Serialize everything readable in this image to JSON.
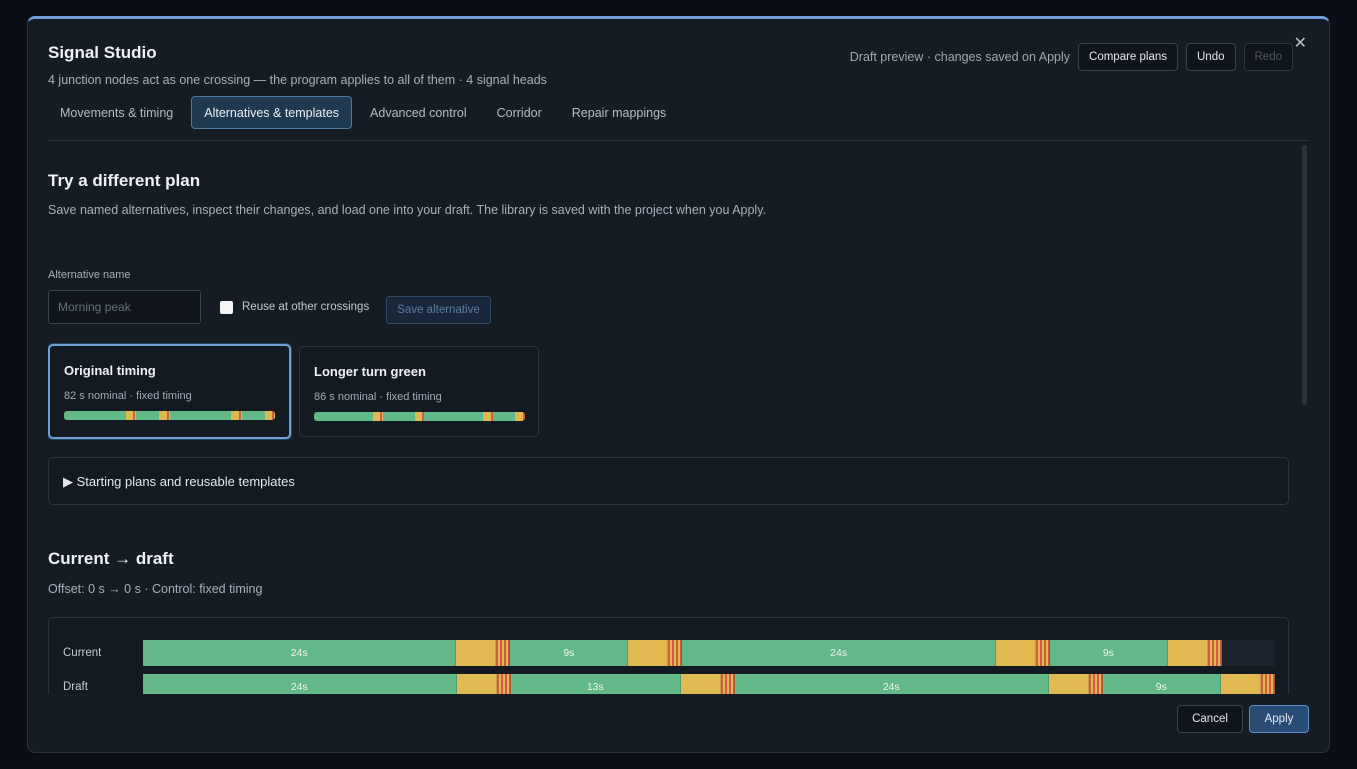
{
  "header": {
    "title": "Signal Studio",
    "subtitle": "4 junction nodes act as one crossing — the program applies to all of them · 4 signal heads",
    "draft_note": "Draft preview · changes saved on Apply",
    "compare_label": "Compare plans",
    "undo_label": "Undo",
    "redo_label": "Redo",
    "close_icon": "close-icon"
  },
  "tabs": [
    {
      "label": "Movements & timing",
      "active": false
    },
    {
      "label": "Alternatives & templates",
      "active": true
    },
    {
      "label": "Advanced control",
      "active": false
    },
    {
      "label": "Corridor",
      "active": false
    },
    {
      "label": "Repair mappings",
      "active": false
    }
  ],
  "alternatives": {
    "heading": "Try a different plan",
    "description": "Save named alternatives, inspect their changes, and load one into your draft. The library is saved with the project when you Apply.",
    "name_label": "Alternative name",
    "name_placeholder": "Morning peak",
    "name_value": "",
    "reuse_label": "Reuse at other crossings",
    "reuse_checked": false,
    "save_label": "Save alternative",
    "cards": [
      {
        "title": "Original timing",
        "subtitle": "82 s nominal · fixed timing",
        "selected": true
      },
      {
        "title": "Longer turn green",
        "subtitle": "86 s nominal · fixed timing",
        "selected": false
      }
    ],
    "templates_summary": "▶ Starting plans and reusable templates"
  },
  "diff": {
    "heading": "Current → draft",
    "summary": "Offset: 0 s → 0 s · Control: fixed timing",
    "rows": [
      {
        "label": "Current",
        "segments": [
          {
            "type": "green",
            "seconds": 24,
            "text": "24s"
          },
          {
            "type": "yellow",
            "seconds": 3,
            "text": ""
          },
          {
            "type": "red",
            "seconds": 1,
            "text": ""
          },
          {
            "type": "green",
            "seconds": 9,
            "text": "9s"
          },
          {
            "type": "yellow",
            "seconds": 3,
            "text": ""
          },
          {
            "type": "red",
            "seconds": 1,
            "text": ""
          },
          {
            "type": "green",
            "seconds": 24,
            "text": "24s"
          },
          {
            "type": "yellow",
            "seconds": 3,
            "text": ""
          },
          {
            "type": "red",
            "seconds": 1,
            "text": ""
          },
          {
            "type": "green",
            "seconds": 9,
            "text": "9s"
          },
          {
            "type": "yellow",
            "seconds": 3,
            "text": ""
          },
          {
            "type": "red",
            "seconds": 1,
            "text": ""
          },
          {
            "type": "empty",
            "seconds": 4,
            "text": ""
          }
        ]
      },
      {
        "label": "Draft",
        "segments": [
          {
            "type": "green",
            "seconds": 24,
            "text": "24s"
          },
          {
            "type": "yellow",
            "seconds": 3,
            "text": ""
          },
          {
            "type": "red",
            "seconds": 1,
            "text": ""
          },
          {
            "type": "green",
            "seconds": 13,
            "text": "13s"
          },
          {
            "type": "yellow",
            "seconds": 3,
            "text": ""
          },
          {
            "type": "red",
            "seconds": 1,
            "text": ""
          },
          {
            "type": "green",
            "seconds": 24,
            "text": "24s"
          },
          {
            "type": "yellow",
            "seconds": 3,
            "text": ""
          },
          {
            "type": "red",
            "seconds": 1,
            "text": ""
          },
          {
            "type": "green",
            "seconds": 9,
            "text": "9s"
          },
          {
            "type": "yellow",
            "seconds": 3,
            "text": ""
          },
          {
            "type": "red",
            "seconds": 1,
            "text": ""
          }
        ]
      }
    ]
  },
  "footer": {
    "cancel_label": "Cancel",
    "apply_label": "Apply"
  },
  "colors": {
    "accent": "#6fa0d6",
    "green_phase": "#63b887",
    "yellow_phase": "#e2b950",
    "red_phase": "#c9603e"
  }
}
